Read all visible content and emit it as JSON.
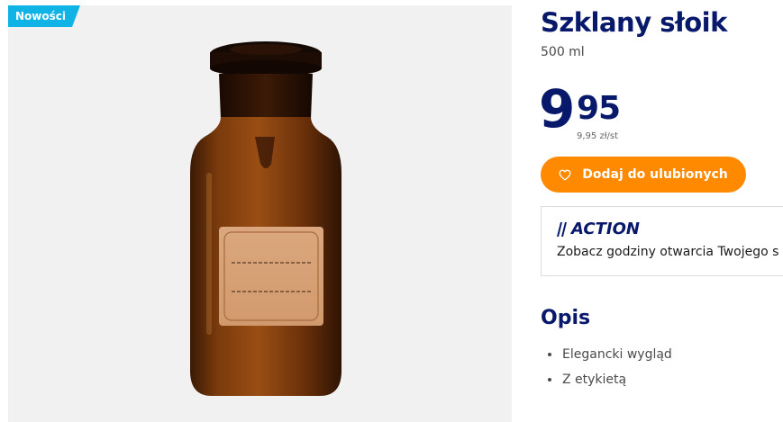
{
  "product": {
    "badge": "Nowości",
    "title": "Szklany słoik",
    "volume": "500 ml",
    "price_main": "9",
    "price_cents": "95",
    "price_unit": "9,95 zł/st"
  },
  "actions": {
    "favorite_label": "Dodaj do ulubionych"
  },
  "store": {
    "brand": "ACTION",
    "hours_text": "Zobacz godziny otwarcia Twojego s"
  },
  "description": {
    "title": "Opis",
    "features": [
      "Elegancki wygląd",
      "Z etykietą"
    ]
  },
  "colors": {
    "brand_navy": "#08196b",
    "badge_blue": "#0fb3e6",
    "button_orange": "#ff8a00"
  },
  "icons": {
    "favorite": "heart-icon",
    "logo": "action-logo"
  }
}
